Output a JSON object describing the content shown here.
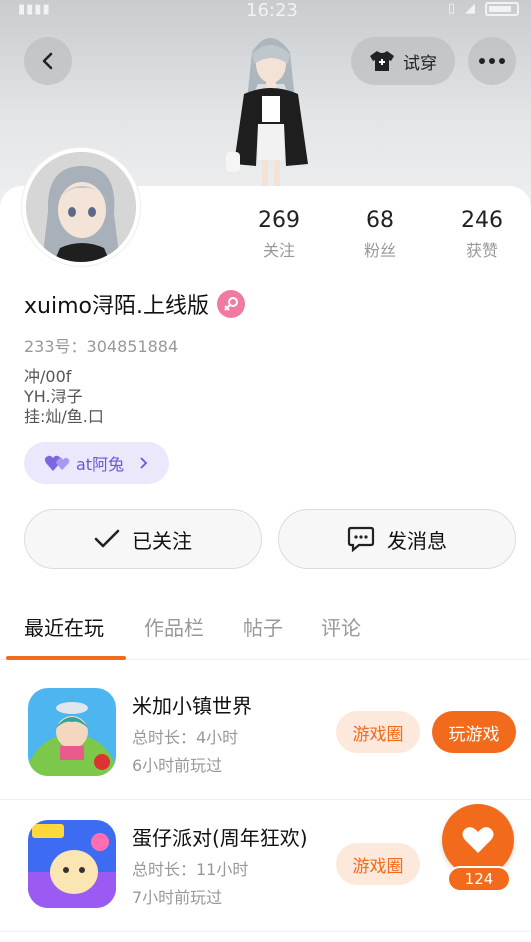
{
  "status_bar": {
    "time": "16:23"
  },
  "header": {
    "try_on_label": "试穿",
    "icons": {
      "back": "back-arrow-icon",
      "try_on": "shirt-icon",
      "more": "more-dots-icon"
    }
  },
  "profile": {
    "stats": [
      {
        "value": "269",
        "label": "关注"
      },
      {
        "value": "68",
        "label": "粉丝"
      },
      {
        "value": "246",
        "label": "获赞"
      }
    ],
    "name": "xuimo浔陌.上线版",
    "gender_icon": "female-icon",
    "uid": "233号：304851884",
    "bio": [
      "冲/00f",
      "YH.浔子",
      "挂:灿/鱼.口"
    ],
    "tag": {
      "label": "at阿兔",
      "icon": "heart-pair-icon"
    }
  },
  "actions": {
    "follow_label": "已关注",
    "message_label": "发消息"
  },
  "tabs": [
    {
      "label": "最近在玩",
      "active": true
    },
    {
      "label": "作品栏",
      "active": false
    },
    {
      "label": "帖子",
      "active": false
    },
    {
      "label": "评论",
      "active": false
    }
  ],
  "games": [
    {
      "title": "米加小镇世界",
      "duration": "总时长：4小时",
      "last_played": "6小时前玩过",
      "circle_label": "游戏圈",
      "play_label": "玩游戏"
    },
    {
      "title": "蛋仔派对(周年狂欢)",
      "duration": "总时长：11小时",
      "last_played": "7小时前玩过",
      "circle_label": "游戏圈"
    }
  ],
  "like_fab": {
    "count": "124"
  },
  "colors": {
    "accent": "#f26a1b",
    "tag_bg": "#ebe8fb",
    "gender_pink": "#f07aa1"
  }
}
